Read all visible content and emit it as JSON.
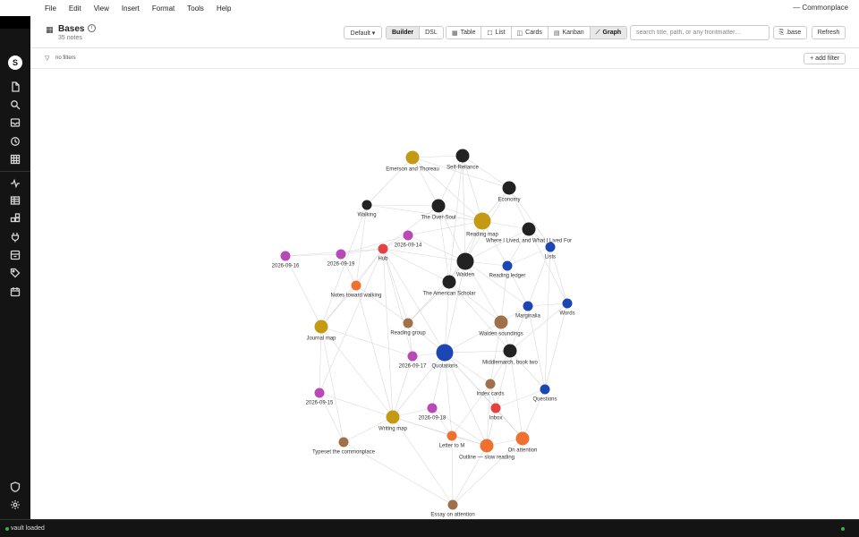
{
  "menu": [
    "File",
    "Edit",
    "View",
    "Insert",
    "Format",
    "Tools",
    "Help"
  ],
  "app_title": "— Commonplace",
  "user_initial": "S",
  "rail_icons": [
    "file-icon",
    "search-icon",
    "inbox-icon",
    "history-icon",
    "grid-icon",
    "activity-icon",
    "table-icon",
    "plugins-icon",
    "plug-icon",
    "archive-icon",
    "tag-icon",
    "calendar-icon"
  ],
  "rail_bottom_icons": [
    "shield-icon",
    "settings-icon"
  ],
  "header": {
    "title": "Bases",
    "subtitle": "35 notes",
    "default_label": "Default ▾",
    "mode": [
      "Builder",
      "DSL"
    ],
    "views": [
      {
        "icon": "▦",
        "label": "Table",
        "active": false
      },
      {
        "icon": "☐",
        "label": "List",
        "active": false
      },
      {
        "icon": "◫",
        "label": "Cards",
        "active": false
      },
      {
        "icon": "▤",
        "label": "Kanban",
        "active": false
      },
      {
        "icon": "⟋",
        "label": "Graph",
        "active": true
      }
    ],
    "search_placeholder": "search title, path, or any frontmatter…",
    "base_button": "⎘ .base",
    "refresh_button": "Refresh"
  },
  "filter": {
    "text": "no filters",
    "add_label": "+ add filter"
  },
  "colors": {
    "gold": "#c49a14",
    "black": "#222222",
    "magenta": "#b84ab8",
    "red": "#e64040",
    "orange": "#f07030",
    "blue": "#1d46b5",
    "brown": "#a0704a"
  },
  "graph": {
    "nodes": [
      {
        "id": "emerson",
        "label": "Emerson and Thoreau",
        "color": "gold",
        "size": "md"
      },
      {
        "id": "selfreliance",
        "label": "Self-Reliance",
        "color": "black",
        "size": "md"
      },
      {
        "id": "economy",
        "label": "Economy",
        "color": "black",
        "size": "md"
      },
      {
        "id": "walking",
        "label": "Walking",
        "color": "black",
        "size": "sm"
      },
      {
        "id": "oversoul",
        "label": "The Over-Soul",
        "color": "black",
        "size": "md"
      },
      {
        "id": "readingmap",
        "label": "Reading map",
        "color": "gold",
        "size": "lg"
      },
      {
        "id": "wherelived",
        "label": "Where I Lived, and What I Lived For",
        "color": "black",
        "size": "md"
      },
      {
        "id": "d0914",
        "label": "2026-09-14",
        "color": "magenta",
        "size": "sm"
      },
      {
        "id": "lists",
        "label": "Lists",
        "color": "blue",
        "size": "sm"
      },
      {
        "id": "d0916",
        "label": "2026-09-16",
        "color": "magenta",
        "size": "sm"
      },
      {
        "id": "d0919",
        "label": "2026-09-19",
        "color": "magenta",
        "size": "sm"
      },
      {
        "id": "hub",
        "label": "Hub",
        "color": "red",
        "size": "sm"
      },
      {
        "id": "walden",
        "label": "Walden",
        "color": "black",
        "size": "lg"
      },
      {
        "id": "readingledger",
        "label": "Reading ledger",
        "color": "blue",
        "size": "sm"
      },
      {
        "id": "notestoward",
        "label": "Notes toward walking",
        "color": "orange",
        "size": "sm"
      },
      {
        "id": "americanscholar",
        "label": "The American Scholar",
        "color": "black",
        "size": "md"
      },
      {
        "id": "marginalia",
        "label": "Marginalia",
        "color": "blue",
        "size": "sm"
      },
      {
        "id": "words",
        "label": "Words",
        "color": "blue",
        "size": "sm"
      },
      {
        "id": "journalmap",
        "label": "Journal map",
        "color": "gold",
        "size": "md"
      },
      {
        "id": "readinggroup",
        "label": "Reading group",
        "color": "brown",
        "size": "sm"
      },
      {
        "id": "waldensoundings",
        "label": "Walden soundings",
        "color": "brown",
        "size": "md"
      },
      {
        "id": "d0917",
        "label": "2026-09-17",
        "color": "magenta",
        "size": "sm"
      },
      {
        "id": "quotations",
        "label": "Quotations",
        "color": "blue",
        "size": "lg"
      },
      {
        "id": "middlemarch",
        "label": "Middlemarch, book two",
        "color": "black",
        "size": "md"
      },
      {
        "id": "indexcards",
        "label": "Index cards",
        "color": "brown",
        "size": "sm"
      },
      {
        "id": "d0915",
        "label": "2026-09-15",
        "color": "magenta",
        "size": "sm"
      },
      {
        "id": "questions",
        "label": "Questions",
        "color": "blue",
        "size": "sm"
      },
      {
        "id": "inbox",
        "label": "Inbox",
        "color": "red",
        "size": "sm"
      },
      {
        "id": "writingmap",
        "label": "Writing map",
        "color": "gold",
        "size": "md"
      },
      {
        "id": "d0918",
        "label": "2026-09-18",
        "color": "magenta",
        "size": "sm"
      },
      {
        "id": "letterto",
        "label": "Letter to M",
        "color": "orange",
        "size": "sm"
      },
      {
        "id": "outline",
        "label": "Outline — slow reading",
        "color": "orange",
        "size": "md"
      },
      {
        "id": "onattention",
        "label": "On attention",
        "color": "orange",
        "size": "md"
      },
      {
        "id": "typeset",
        "label": "Typeset the commonplace",
        "color": "brown",
        "size": "sm"
      },
      {
        "id": "essay",
        "label": "Essay on attention",
        "color": "brown",
        "size": "sm"
      }
    ],
    "edges": [
      [
        "emerson",
        "selfreliance"
      ],
      [
        "emerson",
        "oversoul"
      ],
      [
        "emerson",
        "walking"
      ],
      [
        "emerson",
        "readingmap"
      ],
      [
        "emerson",
        "economy"
      ],
      [
        "selfreliance",
        "readingmap"
      ],
      [
        "selfreliance",
        "oversoul"
      ],
      [
        "selfreliance",
        "walden"
      ],
      [
        "selfreliance",
        "americanscholar"
      ],
      [
        "selfreliance",
        "economy"
      ],
      [
        "economy",
        "readingmap"
      ],
      [
        "economy",
        "walden"
      ],
      [
        "economy",
        "wherelived"
      ],
      [
        "economy",
        "lists"
      ],
      [
        "walking",
        "oversoul"
      ],
      [
        "walking",
        "notestoward"
      ],
      [
        "walking",
        "readingmap"
      ],
      [
        "walking",
        "journalmap"
      ],
      [
        "oversoul",
        "readingmap"
      ],
      [
        "oversoul",
        "walden"
      ],
      [
        "oversoul",
        "americanscholar"
      ],
      [
        "oversoul",
        "hub"
      ],
      [
        "readingmap",
        "walden"
      ],
      [
        "readingmap",
        "wherelived"
      ],
      [
        "readingmap",
        "readingledger"
      ],
      [
        "readingmap",
        "americanscholar"
      ],
      [
        "readingmap",
        "d0914"
      ],
      [
        "wherelived",
        "walden"
      ],
      [
        "wherelived",
        "lists"
      ],
      [
        "wherelived",
        "readingledger"
      ],
      [
        "wherelived",
        "words"
      ],
      [
        "d0914",
        "hub"
      ],
      [
        "d0914",
        "d0919"
      ],
      [
        "d0914",
        "walden"
      ],
      [
        "d0916",
        "hub"
      ],
      [
        "d0916",
        "d0919"
      ],
      [
        "d0916",
        "journalmap"
      ],
      [
        "d0919",
        "hub"
      ],
      [
        "d0919",
        "notestoward"
      ],
      [
        "hub",
        "walden"
      ],
      [
        "hub",
        "notestoward"
      ],
      [
        "hub",
        "readinggroup"
      ],
      [
        "hub",
        "journalmap"
      ],
      [
        "hub",
        "quotations"
      ],
      [
        "hub",
        "d0917"
      ],
      [
        "hub",
        "writingmap"
      ],
      [
        "hub",
        "americanscholar"
      ],
      [
        "hub",
        "d0915"
      ],
      [
        "walden",
        "americanscholar"
      ],
      [
        "walden",
        "readingledger"
      ],
      [
        "walden",
        "waldensoundings"
      ],
      [
        "walden",
        "quotations"
      ],
      [
        "walden",
        "readinggroup"
      ],
      [
        "walden",
        "marginalia"
      ],
      [
        "readingledger",
        "marginalia"
      ],
      [
        "readingledger",
        "lists"
      ],
      [
        "readingledger",
        "waldensoundings"
      ],
      [
        "lists",
        "marginalia"
      ],
      [
        "lists",
        "words"
      ],
      [
        "lists",
        "questions"
      ],
      [
        "notestoward",
        "journalmap"
      ],
      [
        "notestoward",
        "readinggroup"
      ],
      [
        "notestoward",
        "writingmap"
      ],
      [
        "americanscholar",
        "quotations"
      ],
      [
        "americanscholar",
        "waldensoundings"
      ],
      [
        "americanscholar",
        "readinggroup"
      ],
      [
        "americanscholar",
        "middlemarch"
      ],
      [
        "marginalia",
        "words"
      ],
      [
        "marginalia",
        "waldensoundings"
      ],
      [
        "marginalia",
        "middlemarch"
      ],
      [
        "marginalia",
        "questions"
      ],
      [
        "words",
        "questions"
      ],
      [
        "words",
        "middlemarch"
      ],
      [
        "journalmap",
        "d0917"
      ],
      [
        "journalmap",
        "d0915"
      ],
      [
        "journalmap",
        "writingmap"
      ],
      [
        "journalmap",
        "typeset"
      ],
      [
        "readinggroup",
        "quotations"
      ],
      [
        "readinggroup",
        "d0917"
      ],
      [
        "waldensoundings",
        "quotations"
      ],
      [
        "waldensoundings",
        "middlemarch"
      ],
      [
        "waldensoundings",
        "indexcards"
      ],
      [
        "d0917",
        "quotations"
      ],
      [
        "d0917",
        "writingmap"
      ],
      [
        "quotations",
        "middlemarch"
      ],
      [
        "quotations",
        "indexcards"
      ],
      [
        "quotations",
        "d0918"
      ],
      [
        "quotations",
        "letterto"
      ],
      [
        "quotations",
        "outline"
      ],
      [
        "quotations",
        "inbox"
      ],
      [
        "quotations",
        "writingmap"
      ],
      [
        "quotations",
        "onattention"
      ],
      [
        "middlemarch",
        "indexcards"
      ],
      [
        "middlemarch",
        "questions"
      ],
      [
        "middlemarch",
        "inbox"
      ],
      [
        "middlemarch",
        "onattention"
      ],
      [
        "indexcards",
        "inbox"
      ],
      [
        "indexcards",
        "outline"
      ],
      [
        "indexcards",
        "letterto"
      ],
      [
        "d0915",
        "writingmap"
      ],
      [
        "d0915",
        "typeset"
      ],
      [
        "questions",
        "onattention"
      ],
      [
        "questions",
        "inbox"
      ],
      [
        "inbox",
        "onattention"
      ],
      [
        "inbox",
        "outline"
      ],
      [
        "writingmap",
        "d0918"
      ],
      [
        "writingmap",
        "letterto"
      ],
      [
        "writingmap",
        "typeset"
      ],
      [
        "writingmap",
        "essay"
      ],
      [
        "writingmap",
        "outline"
      ],
      [
        "d0918",
        "letterto"
      ],
      [
        "d0918",
        "outline"
      ],
      [
        "letterto",
        "outline"
      ],
      [
        "letterto",
        "essay"
      ],
      [
        "outline",
        "onattention"
      ],
      [
        "outline",
        "essay"
      ],
      [
        "onattention",
        "essay"
      ],
      [
        "typeset",
        "essay"
      ]
    ]
  },
  "status": {
    "text": "vault loaded"
  }
}
